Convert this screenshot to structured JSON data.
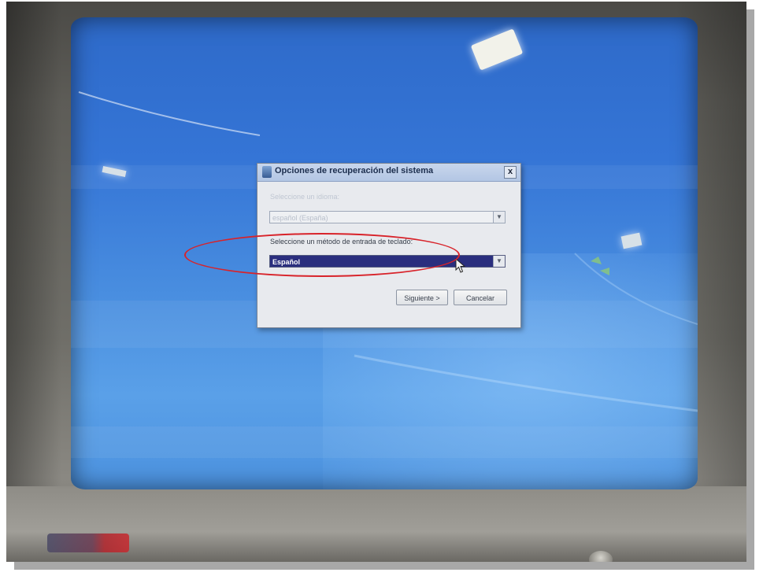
{
  "dialog": {
    "title": "Opciones de recuperación del sistema",
    "close_label": "x",
    "language_label": "Seleccione un idioma:",
    "language_value": "español (España)",
    "keyboard_label": "Seleccione un método de entrada de teclado:",
    "keyboard_value": "Español",
    "next_label": "Siguiente >",
    "cancel_label": "Cancelar"
  },
  "annotation": {
    "highlight_color": "#d8232a"
  },
  "icons": {
    "app": "recovery-app-icon",
    "dropdown": "chevron-down-icon",
    "cursor": "mouse-cursor-icon"
  },
  "colors": {
    "desktop": "#3575d6",
    "selection": "#2a2e7e",
    "bezel": "#5d5c57"
  }
}
